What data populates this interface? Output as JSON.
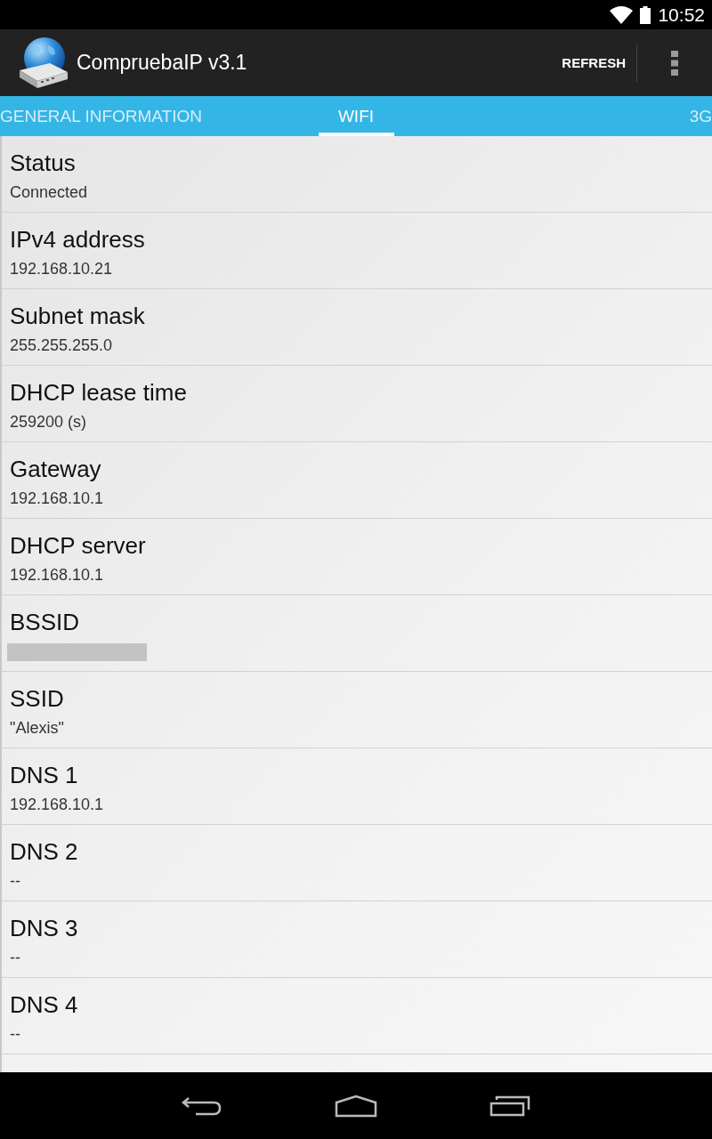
{
  "status_bar": {
    "time": "10:52"
  },
  "action_bar": {
    "title": "CompruebaIP v3.1",
    "actions": [
      "REFRESH"
    ]
  },
  "tabs": [
    {
      "label": "GENERAL INFORMATION",
      "selected": false
    },
    {
      "label": "WIFI",
      "selected": true
    },
    {
      "label": "3G",
      "selected": false
    }
  ],
  "rows": [
    {
      "label": "Status",
      "value": "Connected",
      "redacted": false
    },
    {
      "label": "IPv4 address",
      "value": "192.168.10.21",
      "redacted": false
    },
    {
      "label": "Subnet mask",
      "value": "255.255.255.0",
      "redacted": false
    },
    {
      "label": "DHCP lease time",
      "value": "259200 (s)",
      "redacted": false
    },
    {
      "label": "Gateway",
      "value": "192.168.10.1",
      "redacted": false
    },
    {
      "label": "DHCP server",
      "value": "192.168.10.1",
      "redacted": false
    },
    {
      "label": "BSSID",
      "redacted": true
    },
    {
      "label": "SSID",
      "value": "\"Alexis\"",
      "redacted": false
    },
    {
      "label": "DNS 1",
      "value": "192.168.10.1",
      "redacted": false
    },
    {
      "label": "DNS 2",
      "value": "--",
      "redacted": false
    },
    {
      "label": "DNS 3",
      "value": "--",
      "redacted": false
    },
    {
      "label": "DNS 4",
      "value": "--",
      "redacted": false
    }
  ]
}
